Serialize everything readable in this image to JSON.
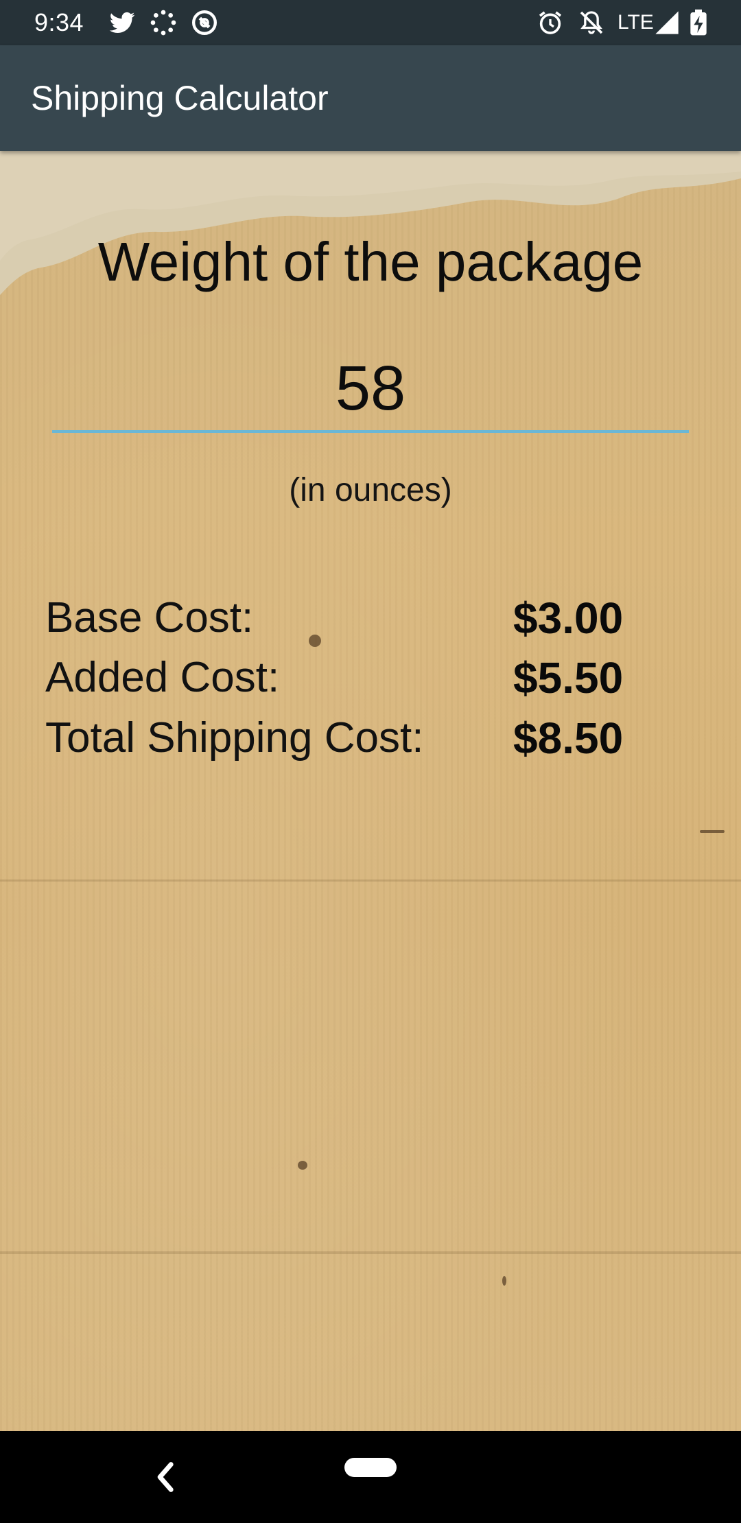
{
  "status_bar": {
    "time": "9:34",
    "network": "LTE",
    "icons": [
      "twitter-icon",
      "loading-icon",
      "app-icon",
      "alarm-icon",
      "notifications-off-icon",
      "signal-icon",
      "battery-charging-icon"
    ]
  },
  "app_bar": {
    "title": "Shipping Calculator",
    "color": "#37474f"
  },
  "main": {
    "weight_heading": "Weight of the package",
    "weight_value": "58",
    "weight_unit_note": "(in ounces)",
    "costs": [
      {
        "label": "Base Cost:",
        "value": "$3.00"
      },
      {
        "label": "Added Cost:",
        "value": "$5.50"
      },
      {
        "label": "Total Shipping Cost:",
        "value": "$8.50"
      }
    ],
    "accent_color": "#6ab7d6"
  },
  "nav_bar": {
    "icons": [
      "back-icon",
      "home-pill-icon"
    ]
  }
}
